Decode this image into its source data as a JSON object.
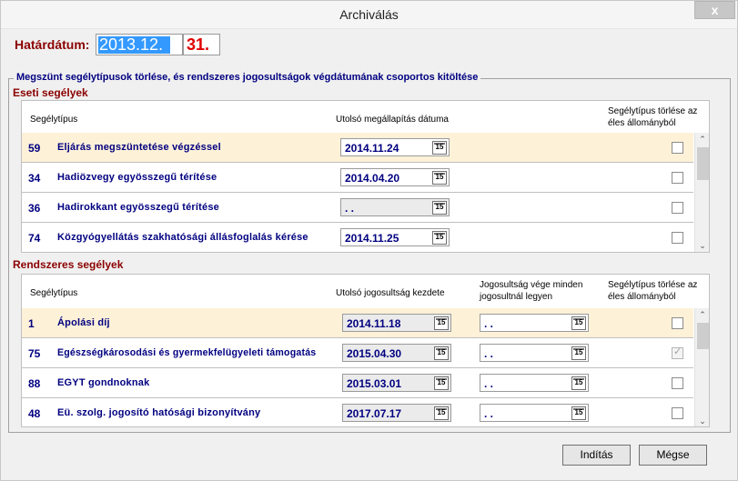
{
  "window": {
    "title": "Archiválás",
    "close_glyph": "x"
  },
  "cutoff": {
    "label": "Határdátum:",
    "date_value": "2013.12.",
    "day_value": "31."
  },
  "group": {
    "title": "Megszünt segélytípusok törlése, és rendszeres jogosultságok végdátumának csoportos kitöltése"
  },
  "eseti": {
    "title": "Eseti segélyek",
    "headers": {
      "type": "Segélytípus",
      "last_date": "Utolsó megállapítás dátuma",
      "delete_line1": "Segélytípus törlése az",
      "delete_line2": "éles állományból"
    },
    "rows": [
      {
        "code": "59",
        "name": "Eljárás megszüntetése végzéssel",
        "date": "2014.11.24",
        "checked": false,
        "selected": true
      },
      {
        "code": "34",
        "name": "Hadiözvegy egyösszegű térítése",
        "date": "2014.04.20",
        "checked": false,
        "selected": false
      },
      {
        "code": "36",
        "name": "Hadirokkant egyösszegű térítése",
        "date": " .  .",
        "checked": false,
        "selected": false
      },
      {
        "code": "74",
        "name": "Közgyógyellátás szakhatósági állásfoglalás kérése",
        "date": "2014.11.25",
        "checked": false,
        "selected": false
      }
    ]
  },
  "rendszeres": {
    "title": "Rendszeres segélyek",
    "headers": {
      "type": "Segélytípus",
      "start_date": "Utolsó jogosultság kezdete",
      "end_line1": "Jogosultság vége minden",
      "end_line2": "jogosultnál legyen",
      "delete_line1": "Segélytípus törlése az",
      "delete_line2": "éles állományból"
    },
    "rows": [
      {
        "code": "1",
        "name": "Ápolási díj",
        "start": "2014.11.18",
        "end": " .  .",
        "checked": false,
        "selected": true
      },
      {
        "code": "75",
        "name": "Egészségkárosodási és gyermekfelügyeleti támogatás",
        "start": "2015.04.30",
        "end": " .  .",
        "checked": true,
        "selected": false
      },
      {
        "code": "88",
        "name": "EGYT gondnoknak",
        "start": "2015.03.01",
        "end": " .  .",
        "checked": false,
        "selected": false
      },
      {
        "code": "48",
        "name": "Eü. szolg. jogosító hatósági bizonyítvány",
        "start": "2017.07.17",
        "end": " .  .",
        "checked": false,
        "selected": false
      }
    ]
  },
  "buttons": {
    "start": "Indítás",
    "cancel": "Mégse"
  },
  "icons": {
    "calendar": "calendar-icon",
    "scroll_up": "chevron-up-icon",
    "scroll_down": "chevron-down-icon",
    "check": "checkmark-icon"
  },
  "colors": {
    "accent_red": "#8b0000",
    "navy": "#000080",
    "selection": "#3399ff",
    "row_highlight": "#fdf1d8"
  }
}
